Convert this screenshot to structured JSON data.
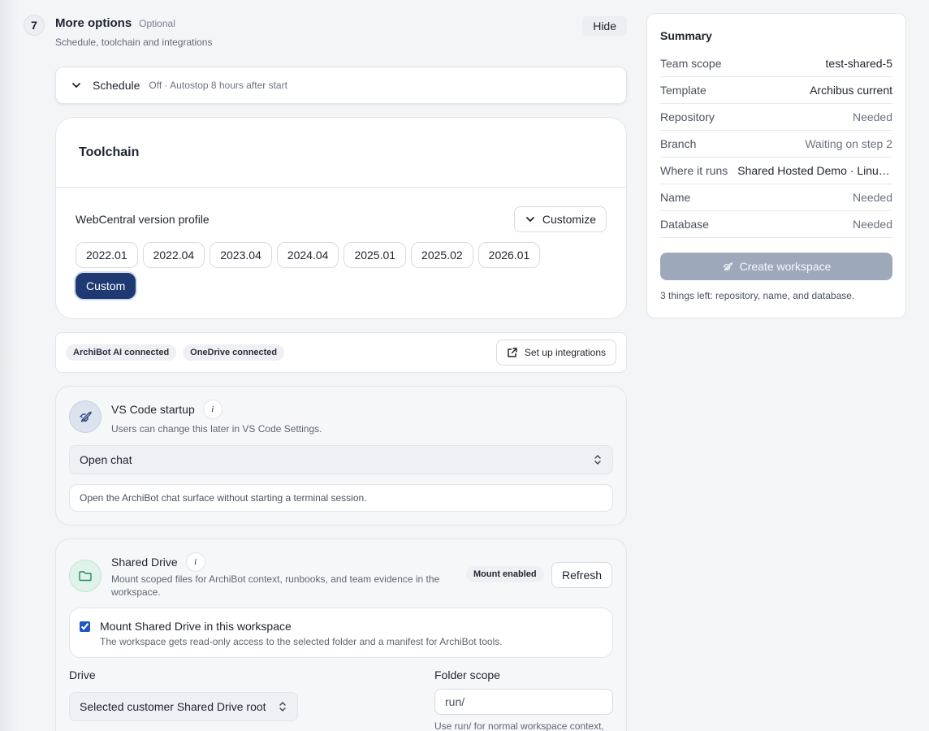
{
  "step": {
    "number": "7",
    "title": "More options",
    "optional": "Optional",
    "subtitle": "Schedule, toolchain and integrations",
    "hide_label": "Hide"
  },
  "schedule": {
    "label": "Schedule",
    "meta": "Off · Autostop 8 hours after start"
  },
  "toolchain": {
    "title": "Toolchain",
    "profile_label": "WebCentral version profile",
    "customize_label": "Customize",
    "versions": [
      "2022.01",
      "2022.04",
      "2023.04",
      "2024.04",
      "2025.01",
      "2025.02",
      "2026.01",
      "Custom"
    ],
    "selected": "Custom"
  },
  "integrations": {
    "chips": [
      "ArchiBot AI connected",
      "OneDrive connected"
    ],
    "setup_label": "Set up integrations"
  },
  "vscode": {
    "title": "VS Code startup",
    "info": "i",
    "subtitle": "Users can change this later in VS Code Settings.",
    "selected": "Open chat",
    "note": "Open the ArchiBot chat surface without starting a terminal session."
  },
  "drive": {
    "title": "Shared Drive",
    "info": "i",
    "subtitle": "Mount scoped files for ArchiBot context, runbooks, and team evidence in the workspace.",
    "badge": "Mount enabled",
    "refresh_label": "Refresh",
    "mount_title": "Mount Shared Drive in this workspace",
    "mount_sub": "The workspace gets read-only access to the selected folder and a manifest for ArchiBot tools.",
    "mount_checked": true,
    "drive_label": "Drive",
    "drive_selected": "Selected customer Shared Drive root",
    "folder_label": "Folder scope",
    "folder_value": "run/",
    "folder_hint": "Use run/ for normal workspace context,"
  },
  "summary": {
    "title": "Summary",
    "rows": [
      {
        "key": "Team scope",
        "value": "test-shared-5",
        "strong": true
      },
      {
        "key": "Template",
        "value": "Archibus current",
        "strong": true
      },
      {
        "key": "Repository",
        "value": "Needed",
        "strong": false
      },
      {
        "key": "Branch",
        "value": "Waiting on step 2",
        "strong": false
      },
      {
        "key": "Where it runs",
        "value": "Shared Hosted Demo · Linux Hosted",
        "strong": true
      },
      {
        "key": "Name",
        "value": "Needed",
        "strong": false
      },
      {
        "key": "Database",
        "value": "Needed",
        "strong": false
      }
    ],
    "create_label": "Create workspace",
    "left_note": "3 things left: repository, name, and database."
  },
  "colors": {
    "accent": "#1f3a73",
    "disabled_button": "#9ea8bb"
  }
}
